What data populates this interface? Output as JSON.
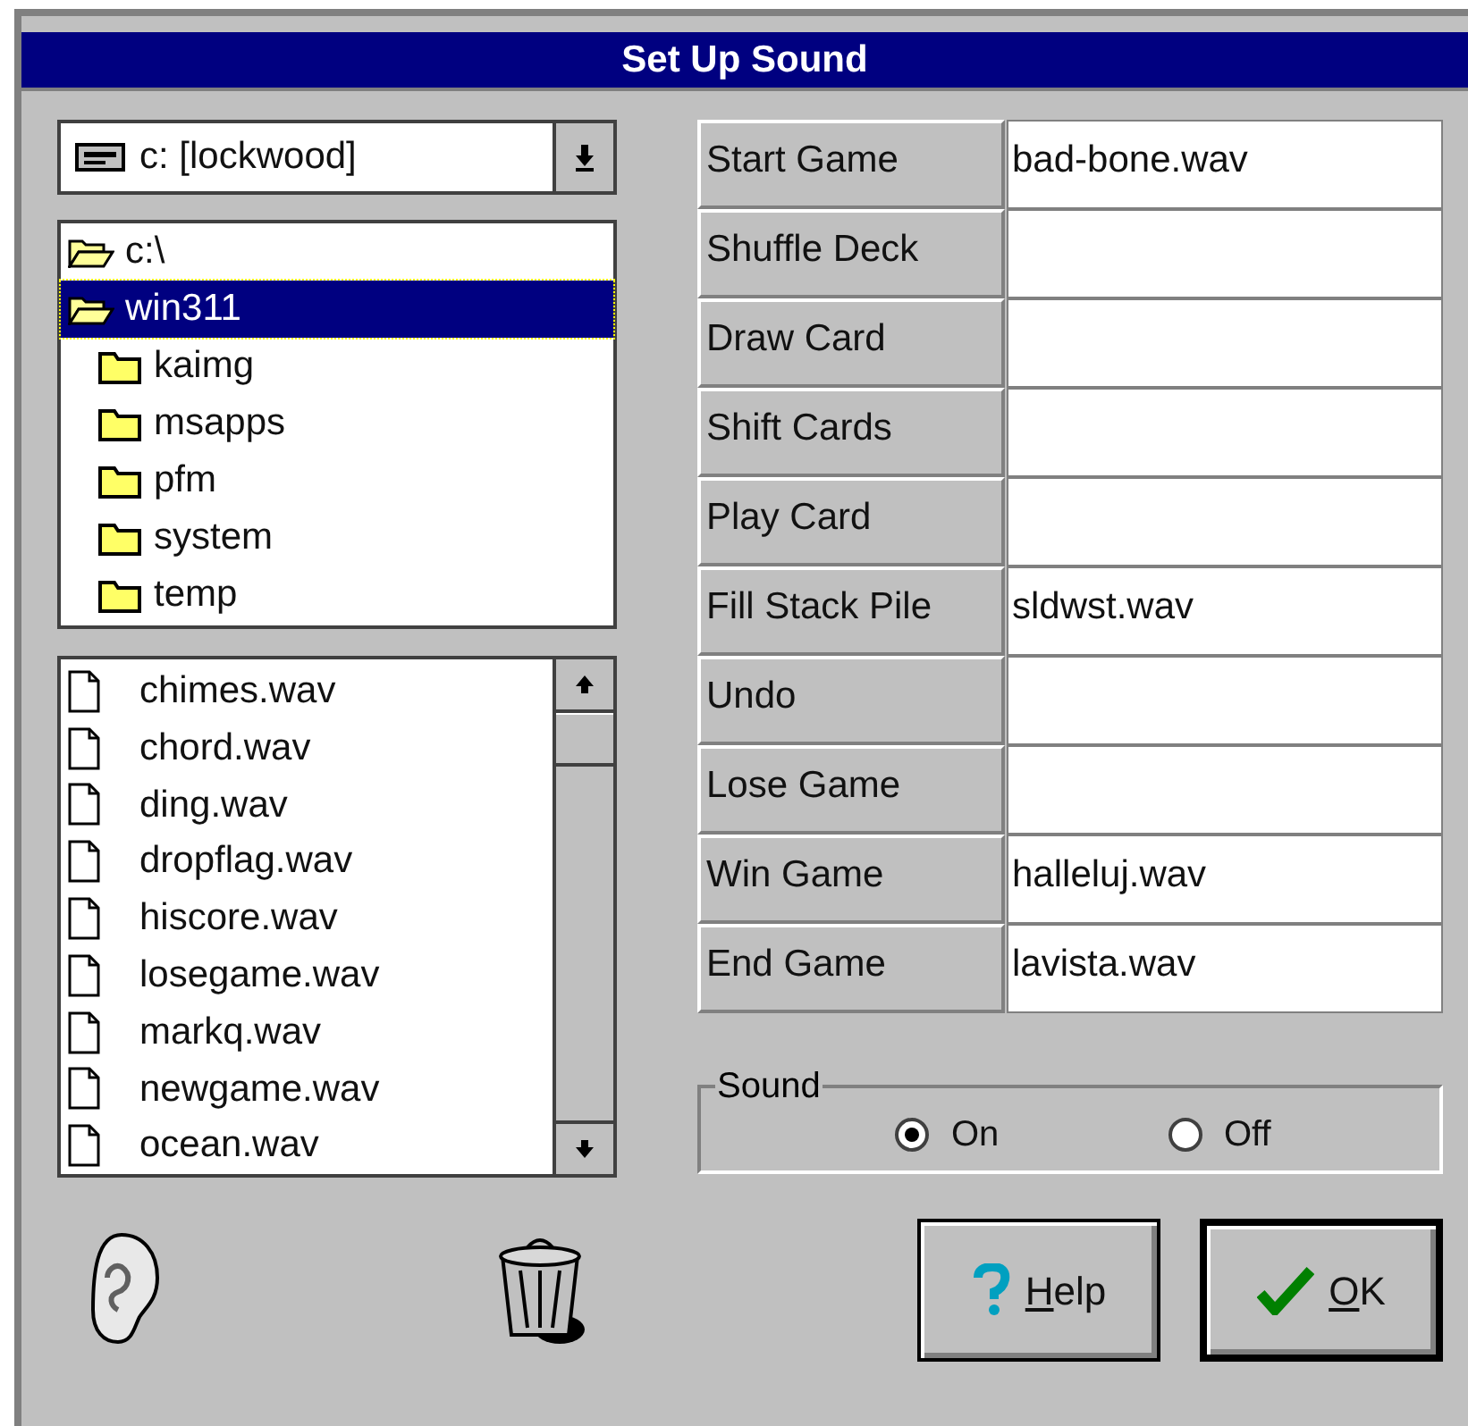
{
  "window": {
    "title": "Set Up Sound"
  },
  "drive": {
    "value": "c: [lockwood]"
  },
  "directories": [
    {
      "name": "c:\\",
      "kind": "open",
      "selected": false
    },
    {
      "name": "win311",
      "kind": "open",
      "selected": true
    },
    {
      "name": "kaimg",
      "kind": "closed",
      "selected": false
    },
    {
      "name": "msapps",
      "kind": "closed",
      "selected": false
    },
    {
      "name": "pfm",
      "kind": "closed",
      "selected": false
    },
    {
      "name": "system",
      "kind": "closed",
      "selected": false
    },
    {
      "name": "temp",
      "kind": "closed",
      "selected": false
    }
  ],
  "files": [
    "chimes.wav",
    "chord.wav",
    "ding.wav",
    "dropflag.wav",
    "hiscore.wav",
    "losegame.wav",
    "markq.wav",
    "newgame.wav",
    "ocean.wav"
  ],
  "events": [
    {
      "label": "Start Game",
      "value": "bad-bone.wav"
    },
    {
      "label": "Shuffle Deck"
    },
    {
      "label": "Draw Card"
    },
    {
      "label": "Shift Cards"
    },
    {
      "label": "Play Card"
    },
    {
      "label": "Fill Stack Pile",
      "value": "sldwst.wav"
    },
    {
      "label": "Undo"
    },
    {
      "label": "Lose Game"
    },
    {
      "label": "Win Game",
      "value": "halleluj.wav"
    },
    {
      "label": "End Game",
      "value": "lavista.wav"
    }
  ],
  "sound": {
    "label": "Sound",
    "options": [
      {
        "label": "On",
        "selected": true
      },
      {
        "label": "Off",
        "selected": false
      }
    ]
  },
  "buttons": [
    {
      "kind": "help",
      "accel": "H",
      "rest": "elp",
      "default": false
    },
    {
      "kind": "ok",
      "accel": "O",
      "rest": "K",
      "default": true
    }
  ]
}
